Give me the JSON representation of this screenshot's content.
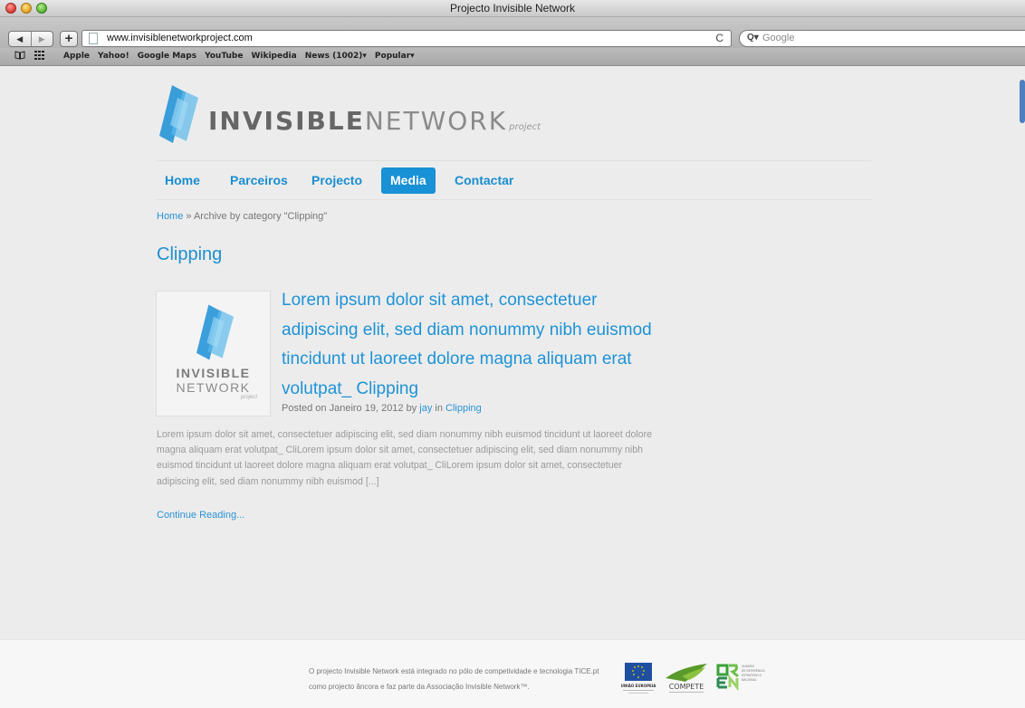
{
  "window": {
    "title": "Projecto Invisible Network"
  },
  "toolbar": {
    "back": "◀",
    "forward": "▶",
    "add": "+",
    "url": "www.invisiblenetworkproject.com",
    "reload": "C",
    "search_icon": "Q▾",
    "search_placeholder": "Google"
  },
  "bookmarks": {
    "items": [
      "Apple",
      "Yahoo!",
      "Google Maps",
      "YouTube",
      "Wikipedia",
      "News (1002)▾",
      "Popular▾"
    ]
  },
  "logo": {
    "bold": "INVISIBLE",
    "light": "NETWORK",
    "small": "project"
  },
  "nav": {
    "items": [
      "Home",
      "Parceiros",
      "Projecto",
      "Media",
      "Contactar"
    ],
    "active": "Media"
  },
  "breadcrumb": {
    "home": "Home",
    "sep": " » ",
    "current": "Archive by category \"Clipping\""
  },
  "category_title": "Clipping",
  "thumbnail": {
    "line1": "INVISIBLE",
    "line2": "NETWORK",
    "line3": "project"
  },
  "post": {
    "title": "Lorem ipsum dolor sit amet, consectetuer adipiscing elit, sed diam nonummy nibh euismod tincidunt ut laoreet dolore magna aliquam erat volutpat_ Clipping",
    "meta_prefix": "Posted on Janeiro 19, 2012 by ",
    "author": "jay",
    "meta_in": " in ",
    "category": "Clipping",
    "excerpt": "Lorem ipsum dolor sit amet, consectetuer adipiscing elit, sed diam nonummy nibh euismod tincidunt ut laoreet dolore magna aliquam erat volutpat_ CliLorem ipsum dolor sit amet, consectetuer adipiscing elit, sed diam nonummy nibh euismod tincidunt ut laoreet dolore magna aliquam erat volutpat_ CliLorem ipsum dolor sit amet, consectetuer adipiscing elit, sed diam nonummy nibh euismod [...]",
    "read_more": "Continue Reading..."
  },
  "footer": {
    "text": "O projecto Invisible Network está integrado no pólo de competividade e tecnologia TICE.pt como projecto âncora e faz parte da Associação Invisible Network™.",
    "logos": {
      "eu": "UNIÃO EUROPEIA",
      "compete": "COMPETE",
      "qren": "QUADRO DE REFERÊNCIA ESTRATÉGICO NACIONAL"
    }
  },
  "colors": {
    "accent": "#1891d6",
    "link": "#2a93d6",
    "text_muted": "#9a9a9a",
    "page_bg": "#ececec"
  }
}
